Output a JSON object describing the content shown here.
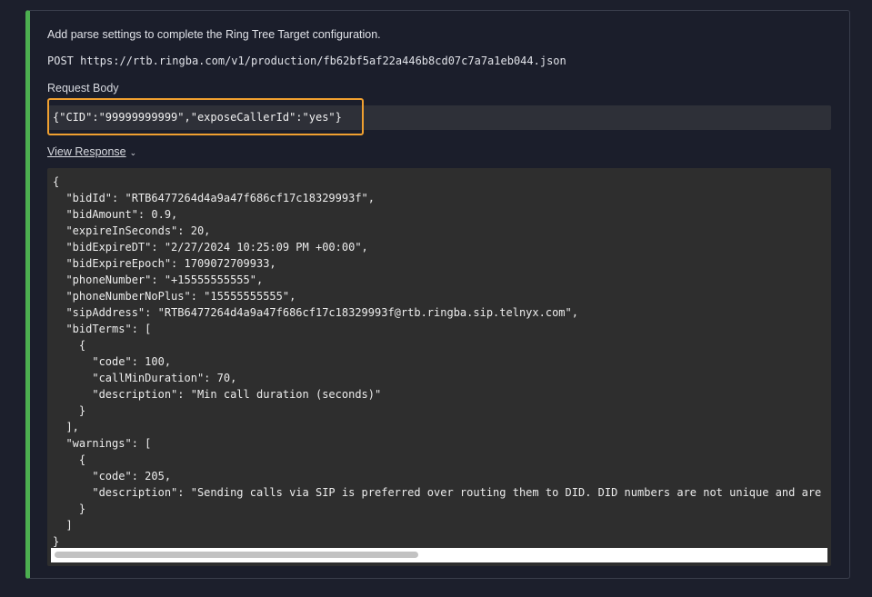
{
  "info_text": "Add parse settings to complete the Ring Tree Target configuration.",
  "post_line": "POST https://rtb.ringba.com/v1/production/fb62bf5af22a446b8cd07c7a7a1eb044.json",
  "request_body_label": "Request Body",
  "request_body": "{\"CID\":\"99999999999\",\"exposeCallerId\":\"yes\"}",
  "view_response_label": "View Response",
  "response_json": "{\n  \"bidId\": \"RTB6477264d4a9a47f686cf17c18329993f\",\n  \"bidAmount\": 0.9,\n  \"expireInSeconds\": 20,\n  \"bidExpireDT\": \"2/27/2024 10:25:09 PM +00:00\",\n  \"bidExpireEpoch\": 1709072709933,\n  \"phoneNumber\": \"+15555555555\",\n  \"phoneNumberNoPlus\": \"15555555555\",\n  \"sipAddress\": \"RTB6477264d4a9a47f686cf17c18329993f@rtb.ringba.sip.telnyx.com\",\n  \"bidTerms\": [\n    {\n      \"code\": 100,\n      \"callMinDuration\": 70,\n      \"description\": \"Min call duration (seconds)\"\n    }\n  ],\n  \"warnings\": [\n    {\n      \"code\": 205,\n      \"description\": \"Sending calls via SIP is preferred over routing them to DID. DID numbers are not unique and are\n    }\n  ]\n}",
  "colors": {
    "accent_bar": "#4caf50",
    "highlight_border": "#f0a030"
  }
}
